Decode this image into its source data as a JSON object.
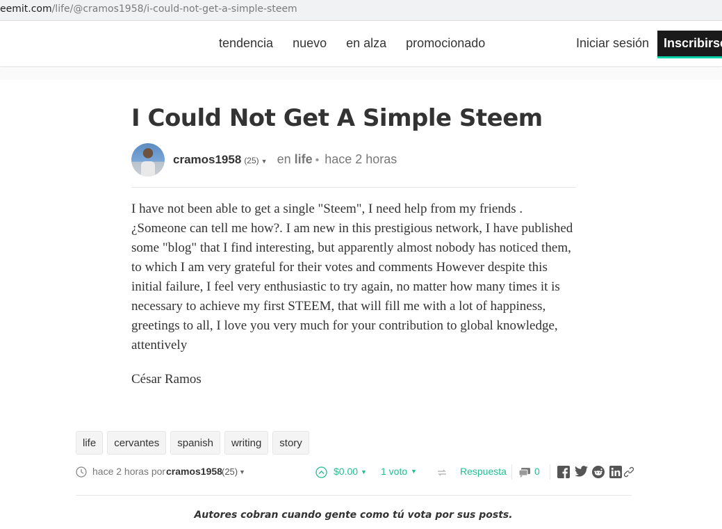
{
  "browser": {
    "url_host": "eemit.com",
    "url_path": "/life/@cramos1958/i-could-not-get-a-simple-steem"
  },
  "header": {
    "nav": [
      "tendencia",
      "nuevo",
      "en alza",
      "promocionado"
    ],
    "login_label": "Iniciar sesión",
    "signup_label": "Inscribirse"
  },
  "post": {
    "title": "I Could Not Get A Simple Steem",
    "author": "cramos1958",
    "reputation": "(25)",
    "category_prefix": "en",
    "category": "life",
    "time": "hace 2 horas",
    "body": "I have not been able to get a single \"Steem\", I need help from my friends . ¿Someone can tell me how?. I am new in this prestigious network, I have published some \"blog\" that I find interesting, but apparently almost nobody has noticed them, to which I am very grateful for their votes and comments However despite this initial failure, I feel very enthusiastic to try again, no matter how many times it is necessary to achieve my first STEEM, that will fill me with a lot of happiness, greetings to all, I love you very much for your contribution to global knowledge, attentively",
    "signature": "César Ramos",
    "tags": [
      "life",
      "cervantes",
      "spanish",
      "writing",
      "story"
    ]
  },
  "footer": {
    "time": "hace 2 horas por",
    "author": "cramos1958",
    "reputation": "(25)",
    "payout": "$0.00",
    "votes": "1 voto",
    "reply_label": "Respuesta",
    "comments_count": "0",
    "promo_text": "Autores cobran cuando gente como tú vota por sus posts."
  },
  "colors": {
    "accent": "#1fbf8f",
    "signup_bg": "#1a1a1a",
    "signup_underline": "#06d6a9"
  }
}
